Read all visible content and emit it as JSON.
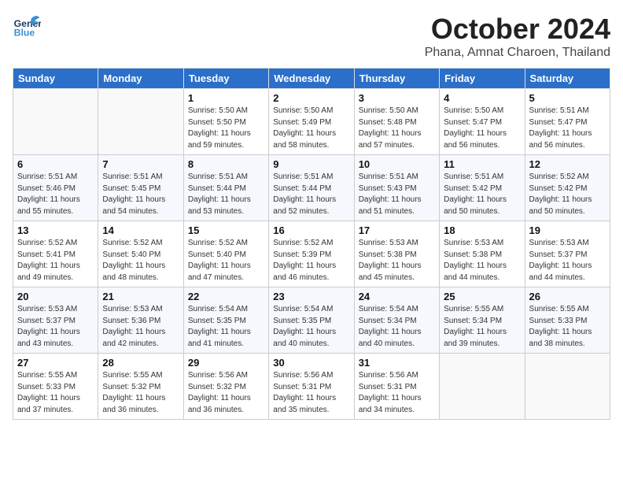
{
  "header": {
    "logo_general": "General",
    "logo_blue": "Blue",
    "month": "October 2024",
    "location": "Phana, Amnat Charoen, Thailand"
  },
  "days_of_week": [
    "Sunday",
    "Monday",
    "Tuesday",
    "Wednesday",
    "Thursday",
    "Friday",
    "Saturday"
  ],
  "weeks": [
    [
      {
        "day": "",
        "detail": ""
      },
      {
        "day": "",
        "detail": ""
      },
      {
        "day": "1",
        "detail": "Sunrise: 5:50 AM\nSunset: 5:50 PM\nDaylight: 11 hours\nand 59 minutes."
      },
      {
        "day": "2",
        "detail": "Sunrise: 5:50 AM\nSunset: 5:49 PM\nDaylight: 11 hours\nand 58 minutes."
      },
      {
        "day": "3",
        "detail": "Sunrise: 5:50 AM\nSunset: 5:48 PM\nDaylight: 11 hours\nand 57 minutes."
      },
      {
        "day": "4",
        "detail": "Sunrise: 5:50 AM\nSunset: 5:47 PM\nDaylight: 11 hours\nand 56 minutes."
      },
      {
        "day": "5",
        "detail": "Sunrise: 5:51 AM\nSunset: 5:47 PM\nDaylight: 11 hours\nand 56 minutes."
      }
    ],
    [
      {
        "day": "6",
        "detail": "Sunrise: 5:51 AM\nSunset: 5:46 PM\nDaylight: 11 hours\nand 55 minutes."
      },
      {
        "day": "7",
        "detail": "Sunrise: 5:51 AM\nSunset: 5:45 PM\nDaylight: 11 hours\nand 54 minutes."
      },
      {
        "day": "8",
        "detail": "Sunrise: 5:51 AM\nSunset: 5:44 PM\nDaylight: 11 hours\nand 53 minutes."
      },
      {
        "day": "9",
        "detail": "Sunrise: 5:51 AM\nSunset: 5:44 PM\nDaylight: 11 hours\nand 52 minutes."
      },
      {
        "day": "10",
        "detail": "Sunrise: 5:51 AM\nSunset: 5:43 PM\nDaylight: 11 hours\nand 51 minutes."
      },
      {
        "day": "11",
        "detail": "Sunrise: 5:51 AM\nSunset: 5:42 PM\nDaylight: 11 hours\nand 50 minutes."
      },
      {
        "day": "12",
        "detail": "Sunrise: 5:52 AM\nSunset: 5:42 PM\nDaylight: 11 hours\nand 50 minutes."
      }
    ],
    [
      {
        "day": "13",
        "detail": "Sunrise: 5:52 AM\nSunset: 5:41 PM\nDaylight: 11 hours\nand 49 minutes."
      },
      {
        "day": "14",
        "detail": "Sunrise: 5:52 AM\nSunset: 5:40 PM\nDaylight: 11 hours\nand 48 minutes."
      },
      {
        "day": "15",
        "detail": "Sunrise: 5:52 AM\nSunset: 5:40 PM\nDaylight: 11 hours\nand 47 minutes."
      },
      {
        "day": "16",
        "detail": "Sunrise: 5:52 AM\nSunset: 5:39 PM\nDaylight: 11 hours\nand 46 minutes."
      },
      {
        "day": "17",
        "detail": "Sunrise: 5:53 AM\nSunset: 5:38 PM\nDaylight: 11 hours\nand 45 minutes."
      },
      {
        "day": "18",
        "detail": "Sunrise: 5:53 AM\nSunset: 5:38 PM\nDaylight: 11 hours\nand 44 minutes."
      },
      {
        "day": "19",
        "detail": "Sunrise: 5:53 AM\nSunset: 5:37 PM\nDaylight: 11 hours\nand 44 minutes."
      }
    ],
    [
      {
        "day": "20",
        "detail": "Sunrise: 5:53 AM\nSunset: 5:37 PM\nDaylight: 11 hours\nand 43 minutes."
      },
      {
        "day": "21",
        "detail": "Sunrise: 5:53 AM\nSunset: 5:36 PM\nDaylight: 11 hours\nand 42 minutes."
      },
      {
        "day": "22",
        "detail": "Sunrise: 5:54 AM\nSunset: 5:35 PM\nDaylight: 11 hours\nand 41 minutes."
      },
      {
        "day": "23",
        "detail": "Sunrise: 5:54 AM\nSunset: 5:35 PM\nDaylight: 11 hours\nand 40 minutes."
      },
      {
        "day": "24",
        "detail": "Sunrise: 5:54 AM\nSunset: 5:34 PM\nDaylight: 11 hours\nand 40 minutes."
      },
      {
        "day": "25",
        "detail": "Sunrise: 5:55 AM\nSunset: 5:34 PM\nDaylight: 11 hours\nand 39 minutes."
      },
      {
        "day": "26",
        "detail": "Sunrise: 5:55 AM\nSunset: 5:33 PM\nDaylight: 11 hours\nand 38 minutes."
      }
    ],
    [
      {
        "day": "27",
        "detail": "Sunrise: 5:55 AM\nSunset: 5:33 PM\nDaylight: 11 hours\nand 37 minutes."
      },
      {
        "day": "28",
        "detail": "Sunrise: 5:55 AM\nSunset: 5:32 PM\nDaylight: 11 hours\nand 36 minutes."
      },
      {
        "day": "29",
        "detail": "Sunrise: 5:56 AM\nSunset: 5:32 PM\nDaylight: 11 hours\nand 36 minutes."
      },
      {
        "day": "30",
        "detail": "Sunrise: 5:56 AM\nSunset: 5:31 PM\nDaylight: 11 hours\nand 35 minutes."
      },
      {
        "day": "31",
        "detail": "Sunrise: 5:56 AM\nSunset: 5:31 PM\nDaylight: 11 hours\nand 34 minutes."
      },
      {
        "day": "",
        "detail": ""
      },
      {
        "day": "",
        "detail": ""
      }
    ]
  ]
}
